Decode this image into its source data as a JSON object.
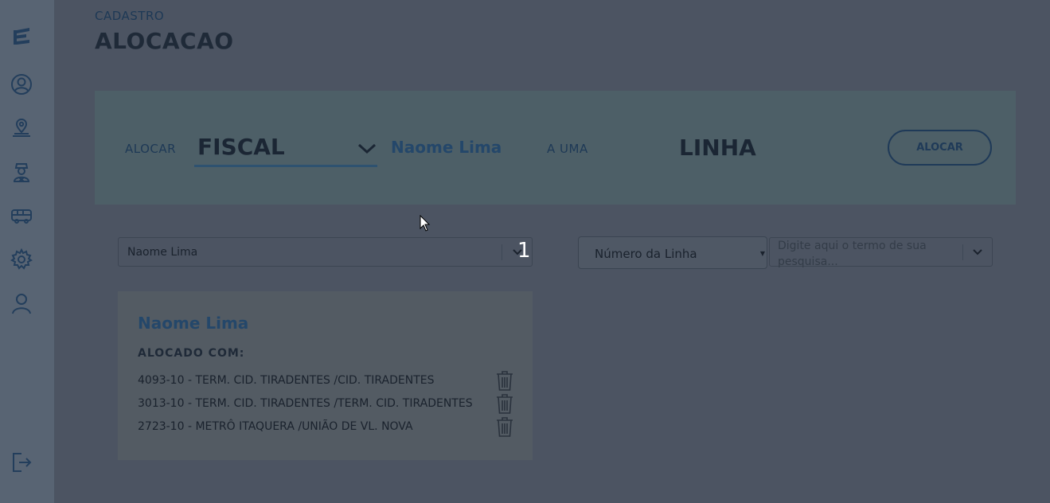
{
  "sidebar": {
    "icons": [
      "logo-icon",
      "user-circle-icon",
      "location-pin-icon",
      "inspector-icon",
      "bus-icon",
      "gear-icon",
      "person-icon",
      "logout-icon"
    ]
  },
  "header": {
    "kicker": "CADASTRO",
    "title": "ALOCACAO"
  },
  "allocation": {
    "label_allocate": "ALOCAR",
    "role_selected": "FISCAL",
    "person_name": "Naome Lima",
    "label_to_a": "A UMA",
    "target": "LINHA",
    "button_label": "ALOCAR"
  },
  "filters": {
    "person_value": "Naome Lima",
    "step_number": "1",
    "line_type_value": "Número da Linha",
    "search_placeholder": "Digite aqui o termo de sua pesquisa..."
  },
  "card": {
    "name": "Naome Lima",
    "subtitle": "ALOCADO COM:",
    "rows": [
      {
        "text": "4093-10 - TERM. CID. TIRADENTES /CID. TIRADENTES"
      },
      {
        "text": "3013-10 - TERM. CID. TIRADENTES /TERM. CID. TIRADENTES"
      },
      {
        "text": "2723-10 - METRÔ ITAQUERA /UNIÃO DE VL. NOVA"
      }
    ]
  },
  "colors": {
    "overlay_background": "#4c5462",
    "panel_background": "#4d5f67",
    "accent_blue": "#24476a",
    "step_number": "#ffffff"
  }
}
